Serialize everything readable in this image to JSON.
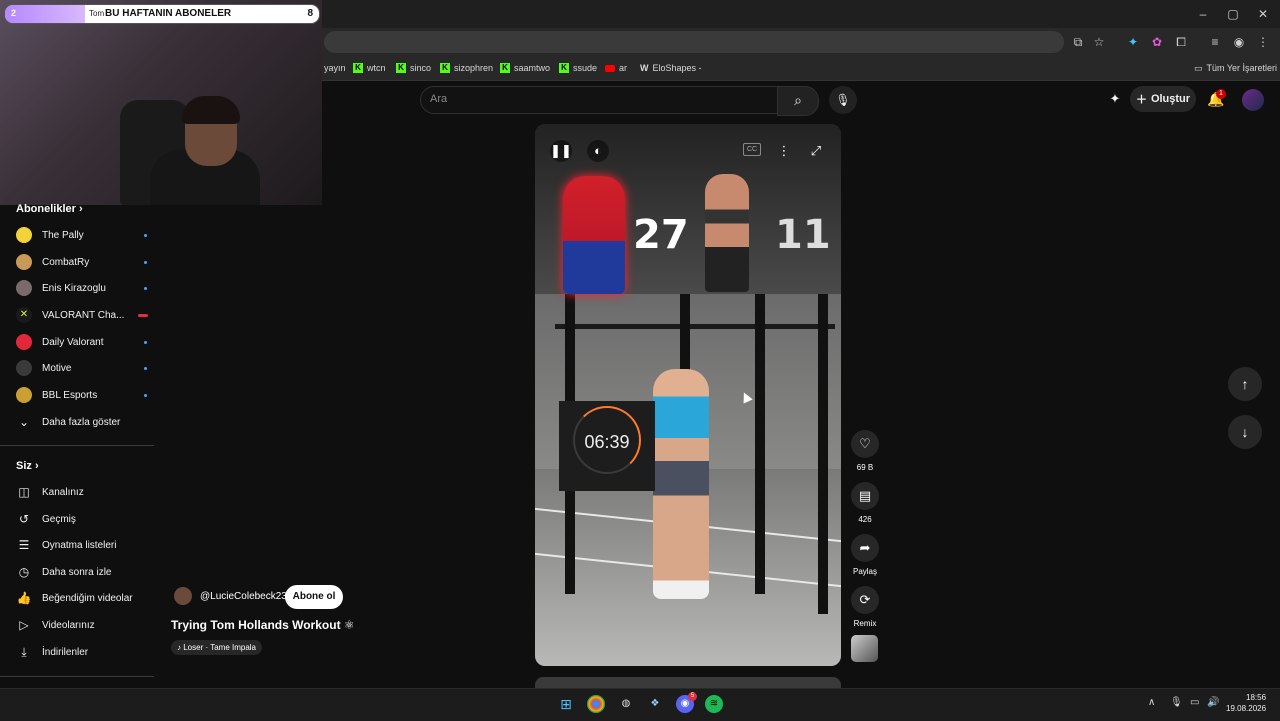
{
  "browser": {
    "window_controls": [
      "–",
      "▢",
      "✕"
    ],
    "bookmarks": [
      {
        "label": "yayın",
        "icon": "none"
      },
      {
        "label": "wtcn",
        "icon": "kick"
      },
      {
        "label": "sinco",
        "icon": "kick"
      },
      {
        "label": "sizophren",
        "icon": "kick"
      },
      {
        "label": "saamtwo",
        "icon": "kick"
      },
      {
        "label": "ssude",
        "icon": "kick"
      },
      {
        "label": "ar",
        "icon": "youtube"
      },
      {
        "label": "EloShapes -",
        "icon": "eloshapes"
      }
    ],
    "all_bookmarks_label": "Tüm Yer İşaretleri"
  },
  "webcam": {
    "goal_label": "BU HAFTANIN ABONELER",
    "left_label": "Tom",
    "count": "8",
    "progress_value": "2"
  },
  "header": {
    "search_placeholder": "Ara",
    "create_label": "Oluştur",
    "notifications_count": "1"
  },
  "sidebar": {
    "subscriptions_title": "Abonelikler",
    "subscriptions": [
      {
        "name": "The Pally",
        "color": "#f2d33a"
      },
      {
        "name": "CombatRy",
        "color": "#c89a5a"
      },
      {
        "name": "Enis Kirazoglu",
        "color": "#7a6a6a"
      },
      {
        "name": "VALORANT Cha...",
        "color": "#d4f542"
      },
      {
        "name": "Daily Valorant",
        "color": "#e0283a"
      },
      {
        "name": "Motive",
        "color": "#3a3a3a"
      },
      {
        "name": "BBL Esports",
        "color": "#caa032"
      }
    ],
    "show_more": "Daha fazla göster",
    "you_title": "Siz",
    "you_items": [
      {
        "label": "Kanalınız",
        "icon": "user-square-icon",
        "glyph": "◫"
      },
      {
        "label": "Geçmiş",
        "icon": "history-icon",
        "glyph": "↺"
      },
      {
        "label": "Oynatma listeleri",
        "icon": "playlist-icon",
        "glyph": "☰"
      },
      {
        "label": "Daha sonra izle",
        "icon": "clock-icon",
        "glyph": "◷"
      },
      {
        "label": "Beğendiğim videolar",
        "icon": "thumb-up-icon",
        "glyph": "👍"
      },
      {
        "label": "Videolarınız",
        "icon": "video-icon",
        "glyph": "▷"
      },
      {
        "label": "İndirilenler",
        "icon": "download-icon",
        "glyph": "⤓"
      }
    ]
  },
  "video": {
    "score_left": "27",
    "score_right": "11",
    "timer": "06:39",
    "channel": "@LucieColebeck23",
    "subscribe_label": "Abone ol",
    "title": "Trying Tom Hollands Workout ⚛",
    "music": "♪ Loser · Tame Impala"
  },
  "actions": {
    "likes": "69 B",
    "comments": "426",
    "share": "Paylaş",
    "remix": "Remix"
  },
  "taskbar": {
    "time": "18:56",
    "date": "19.08.2026",
    "discord_badge": "5"
  }
}
